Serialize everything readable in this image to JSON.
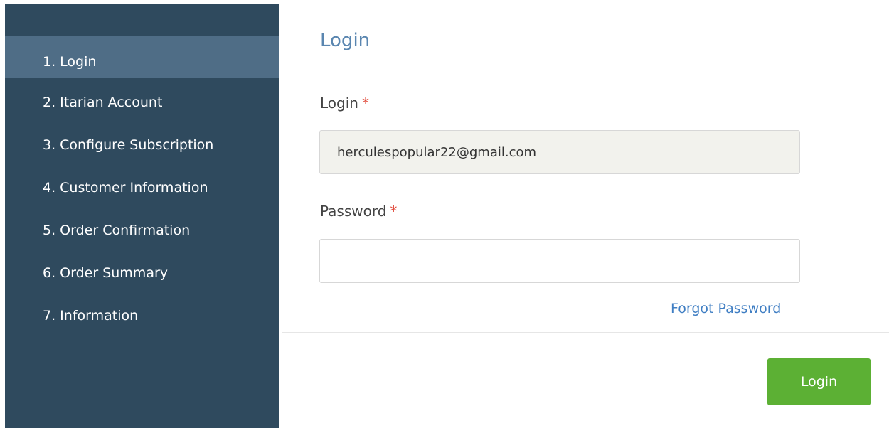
{
  "sidebar": {
    "items": [
      {
        "label": "1. Login",
        "active": true
      },
      {
        "label": "2. Itarian Account",
        "active": false
      },
      {
        "label": "3. Configure Subscription",
        "active": false
      },
      {
        "label": "4. Customer Information",
        "active": false
      },
      {
        "label": "5. Order Confirmation",
        "active": false
      },
      {
        "label": "6. Order Summary",
        "active": false
      },
      {
        "label": "7. Information",
        "active": false
      }
    ]
  },
  "form": {
    "title": "Login",
    "login_label": "Login",
    "login_value": "herculespopular22@gmail.com",
    "password_label": "Password",
    "password_value": "",
    "required_mark": "*",
    "forgot_password": "Forgot Password",
    "login_button": "Login"
  },
  "colors": {
    "sidebar_bg": "#2f4a5e",
    "sidebar_active_bg": "#4f6d86",
    "title": "#5a86b0",
    "required": "#e14a3b",
    "link": "#3f7ec3",
    "button": "#5cb034"
  }
}
